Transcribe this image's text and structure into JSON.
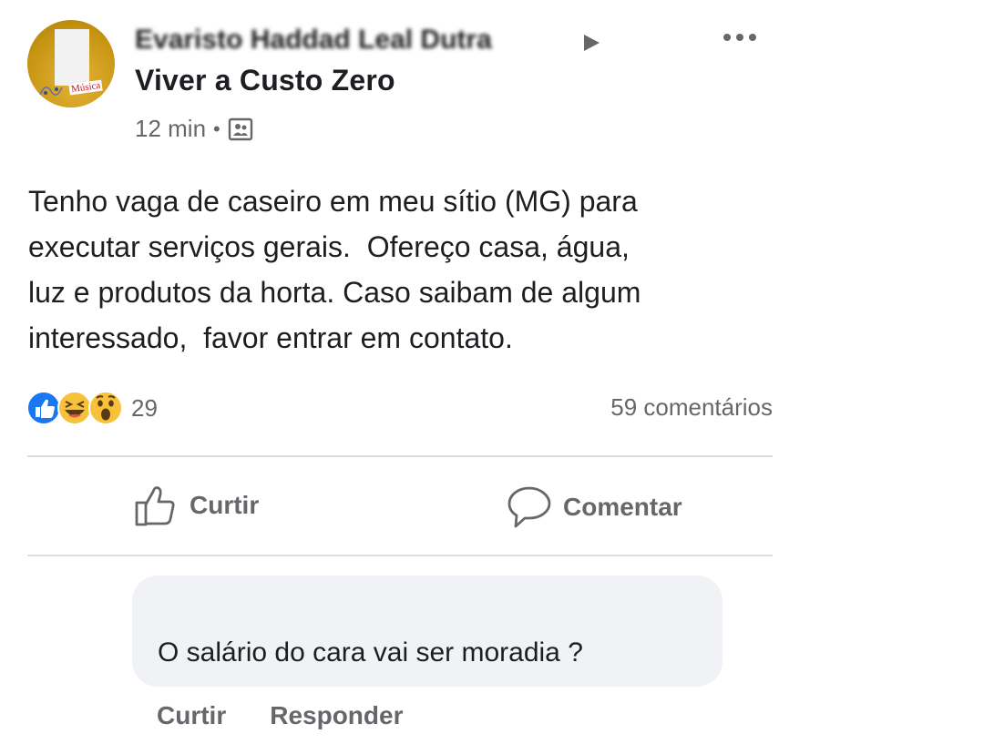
{
  "post": {
    "author_name": "Evaristo Haddad Leal Dutra",
    "group_name": "Viver a Custo Zero",
    "time": "12 min",
    "separator": "•",
    "privacy_icon": "group-icon",
    "avatar_logo_text": "Música",
    "body": "Tenho vaga de caseiro em meu sítio (MG) para\nexecutar serviços gerais.  Ofereço casa, água,\nluz e produtos da horta. Caso saibam de algum\ninteressado,  favor entrar em contato."
  },
  "stats": {
    "reaction_icons": [
      "like-icon",
      "haha-icon",
      "wow-icon"
    ],
    "reaction_count": "29",
    "comment_count": "59 comentários"
  },
  "actions": {
    "like_label": "Curtir",
    "comment_label": "Comentar"
  },
  "comment": {
    "text": "O salário do cara vai ser moradia ?",
    "like_label": "Curtir",
    "reply_label": "Responder"
  },
  "colors": {
    "primary_text": "#1c1e21",
    "secondary_text": "#65676b",
    "divider": "#dadde1",
    "comment_bg": "#f0f2f5",
    "like_blue": "#1877f2",
    "emoji_yellow": "#f7c23a"
  }
}
